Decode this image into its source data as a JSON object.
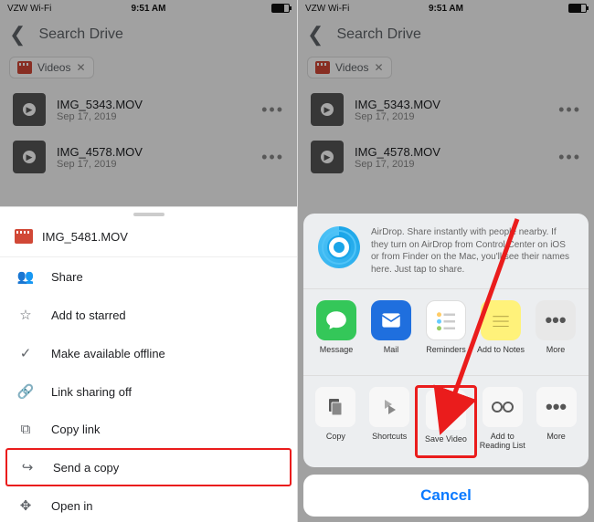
{
  "status": {
    "carrier": "VZW Wi-Fi",
    "time": "9:51 AM"
  },
  "nav": {
    "title": "Search Drive"
  },
  "chip": {
    "label": "Videos"
  },
  "files": [
    {
      "name": "IMG_5343.MOV",
      "date": "Sep 17, 2019"
    },
    {
      "name": "IMG_4578.MOV",
      "date": "Sep 17, 2019"
    }
  ],
  "sheet_left": {
    "filename": "IMG_5481.MOV",
    "items": [
      {
        "icon": "share",
        "label": "Share"
      },
      {
        "icon": "star",
        "label": "Add to starred"
      },
      {
        "icon": "offline",
        "label": "Make available offline"
      },
      {
        "icon": "linkoff",
        "label": "Link sharing off"
      },
      {
        "icon": "copylink",
        "label": "Copy link"
      },
      {
        "icon": "send",
        "label": "Send a copy",
        "highlight": true
      },
      {
        "icon": "openin",
        "label": "Open in"
      }
    ]
  },
  "share": {
    "airdrop": "AirDrop. Share instantly with people nearby. If they turn on AirDrop from Control Center on iOS or from Finder on the Mac, you'll see their names here. Just tap to share.",
    "apps": [
      {
        "name": "Message",
        "bg": "#34c759",
        "glyph": "msg"
      },
      {
        "name": "Mail",
        "bg": "#1f6fde",
        "glyph": "mail"
      },
      {
        "name": "Reminders",
        "bg": "#ffffff",
        "glyph": "rem"
      },
      {
        "name": "Add to Notes",
        "bg": "#fff27a",
        "glyph": "note"
      },
      {
        "name": "More",
        "bg": "#e8e8e8",
        "glyph": "more"
      }
    ],
    "actions": [
      {
        "name": "Copy",
        "glyph": "copy"
      },
      {
        "name": "Shortcuts",
        "glyph": "shortcuts"
      },
      {
        "name": "Save Video",
        "glyph": "save",
        "highlight": true
      },
      {
        "name": "Add to Reading List",
        "glyph": "glasses"
      },
      {
        "name": "More",
        "glyph": "more"
      }
    ],
    "cancel": "Cancel"
  }
}
